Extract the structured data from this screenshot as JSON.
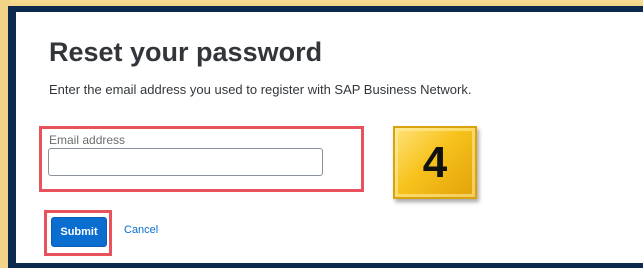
{
  "page": {
    "title": "Reset your password",
    "subtitle": "Enter the email address you used to register with SAP Business Network."
  },
  "form": {
    "email_label": "Email address",
    "email_value": "",
    "email_placeholder": "",
    "submit_label": "Submit",
    "cancel_label": "Cancel"
  },
  "annotation": {
    "step_number": "4"
  },
  "colors": {
    "primary_button": "#0a6ed1",
    "highlight_box": "#e8525c",
    "frame": "#0c2a4e",
    "badge": "#f7c21c"
  }
}
